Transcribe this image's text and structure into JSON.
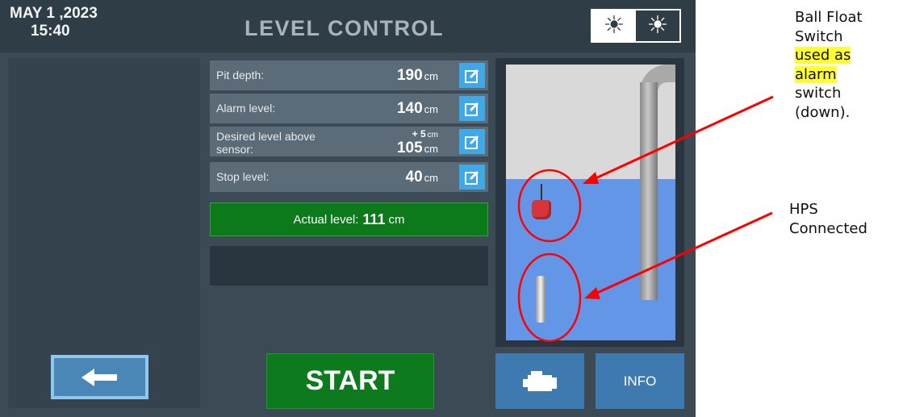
{
  "header": {
    "date": "MAY 1 ,2023",
    "time": "15:40",
    "title": "LEVEL CONTROL",
    "brightness_low_icon": "sun-dim-icon",
    "brightness_high_icon": "sun-bright-icon"
  },
  "parameters": [
    {
      "label": "Pit depth:",
      "value": "190",
      "unit": "cm"
    },
    {
      "label": "Alarm level:",
      "value": "140",
      "unit": "cm"
    },
    {
      "label": "Desired level above sensor:",
      "offset": "+ 5",
      "offset_unit": "cm",
      "value": "105",
      "unit": "cm"
    },
    {
      "label": "Stop level:",
      "value": "40",
      "unit": "cm"
    }
  ],
  "actual": {
    "label": "Actual level:",
    "value": "111",
    "unit": "cm"
  },
  "buttons": {
    "back_icon": "arrow-left-icon",
    "start": "START",
    "engine_icon": "engine-icon",
    "info": "INFO",
    "edit_icon": "edit-icon"
  },
  "annotations": {
    "float": {
      "line1": "Ball Float",
      "line2": "Switch",
      "line3": "used as",
      "line4": "alarm",
      "line5": "switch",
      "line6": "(down)."
    },
    "hps": {
      "line1": "HPS",
      "line2": "Connected"
    }
  },
  "colors": {
    "background": "#3b4a55",
    "header": "#2f3d47",
    "accent": "#3fa9e8",
    "start": "#0d7a1d",
    "water": "#6496e8",
    "annotation_red": "#ff0000",
    "highlight": "#ffff33"
  }
}
